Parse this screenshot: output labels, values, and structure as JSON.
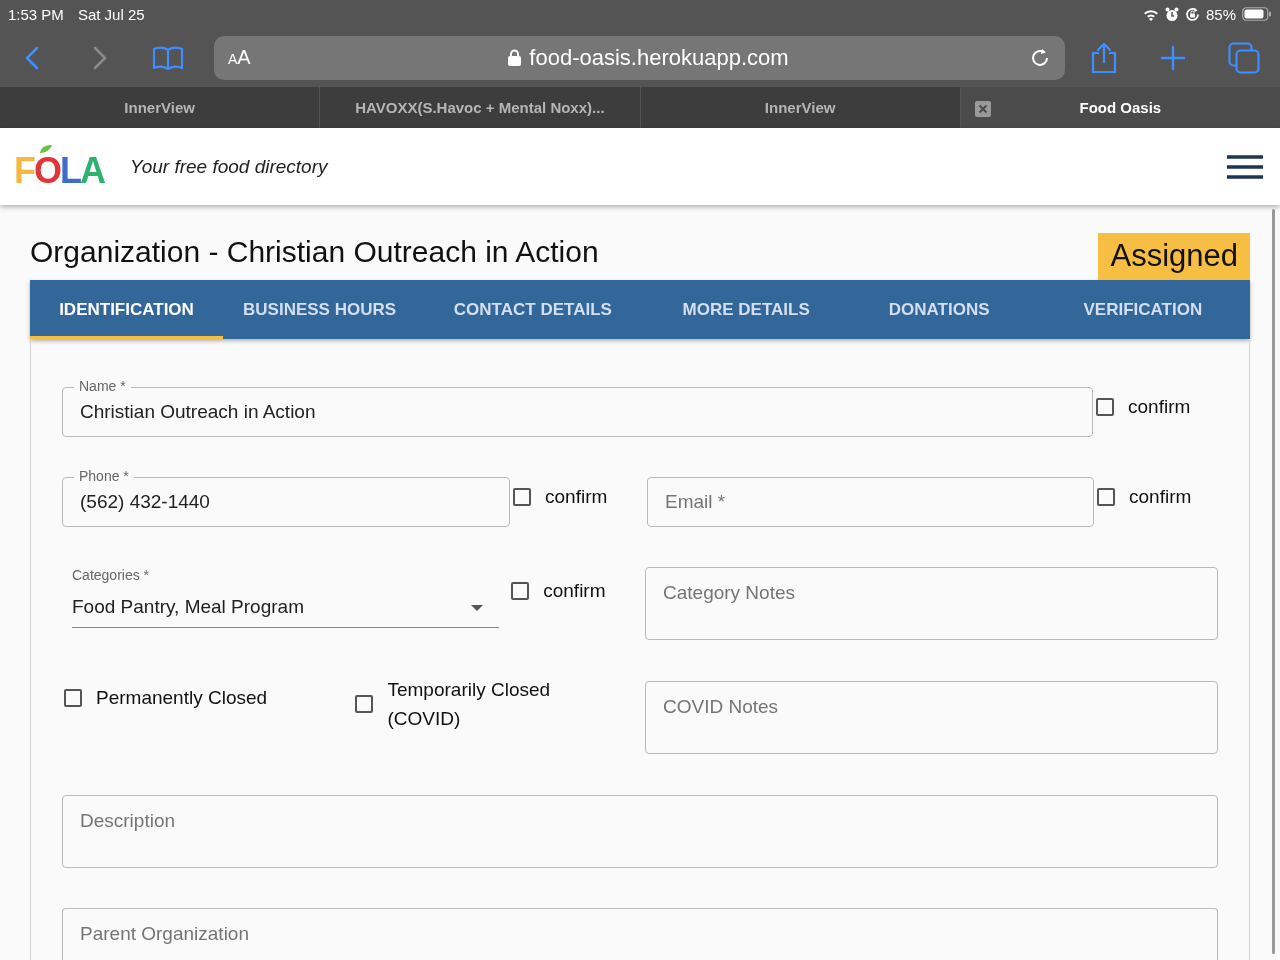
{
  "status_bar": {
    "time": "1:53 PM",
    "date": "Sat Jul 25",
    "battery": "85%"
  },
  "browser": {
    "text_size_button": "AA",
    "url": "food-oasis.herokuapp.com",
    "tabs": [
      {
        "title": "InnerView",
        "selected": false
      },
      {
        "title": "HAVOXX(S.Havoc + Mental Noxx)...",
        "selected": false
      },
      {
        "title": "InnerView",
        "selected": false
      },
      {
        "title": "Food Oasis",
        "selected": true
      }
    ]
  },
  "app_header": {
    "logo": "FOLA",
    "tagline": "Your free food directory"
  },
  "page": {
    "title": "Organization - Christian Outreach in Action",
    "status_badge": "Assigned"
  },
  "form_tabs": [
    {
      "label": "IDENTIFICATION",
      "selected": true
    },
    {
      "label": "BUSINESS HOURS",
      "selected": false
    },
    {
      "label": "CONTACT DETAILS",
      "selected": false
    },
    {
      "label": "MORE DETAILS",
      "selected": false
    },
    {
      "label": "DONATIONS",
      "selected": false
    },
    {
      "label": "VERIFICATION",
      "selected": false
    }
  ],
  "form": {
    "name": {
      "label": "Name *",
      "value": "Christian Outreach in Action",
      "confirm": {
        "label": "confirm",
        "checked": false
      }
    },
    "phone": {
      "label": "Phone *",
      "value": "(562) 432-1440",
      "confirm": {
        "label": "confirm",
        "checked": false
      }
    },
    "email": {
      "placeholder": "Email *",
      "confirm": {
        "label": "confirm",
        "checked": false
      }
    },
    "categories": {
      "label": "Categories *",
      "value": "Food Pantry, Meal Program",
      "confirm": {
        "label": "confirm",
        "checked": false
      }
    },
    "category_notes": {
      "placeholder": "Category Notes"
    },
    "permanently_closed": {
      "label": "Permanently Closed",
      "checked": false
    },
    "temporarily_closed": {
      "label": "Temporarily Closed (COVID)",
      "checked": false
    },
    "covid_notes": {
      "placeholder": "COVID Notes"
    },
    "description": {
      "placeholder": "Description"
    },
    "parent_organization": {
      "placeholder": "Parent Organization"
    }
  }
}
